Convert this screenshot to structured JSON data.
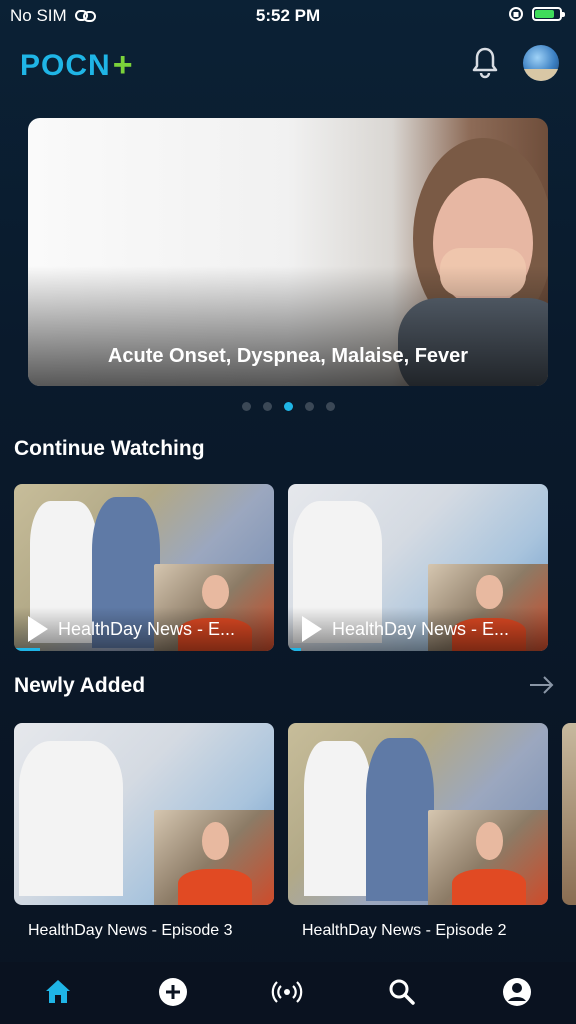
{
  "status_bar": {
    "carrier": "No SIM",
    "time": "5:52 PM",
    "battery_level": 0.8
  },
  "header": {
    "logo_text": "POCN",
    "logo_plus": "+",
    "brand_color": "#1fb5e6",
    "plus_color": "#7bd23a"
  },
  "hero": {
    "title": "Acute Onset, Dyspnea, Malaise, Fever",
    "slide_count": 5,
    "active_index": 2
  },
  "continue_watching": {
    "title": "Continue Watching",
    "items": [
      {
        "label": "HealthDay News - E...",
        "progress": 0.1
      },
      {
        "label": "HealthDay News - E...",
        "progress": 0.05
      }
    ]
  },
  "newly_added": {
    "title": "Newly Added",
    "items": [
      {
        "label": "HealthDay News - Episode 3"
      },
      {
        "label": "HealthDay News - Episode 2"
      }
    ]
  },
  "tab_bar": {
    "items": [
      "home-icon",
      "add-icon",
      "live-icon",
      "search-icon",
      "profile-icon"
    ],
    "active": "home-icon",
    "active_color": "#1fb5e6"
  }
}
